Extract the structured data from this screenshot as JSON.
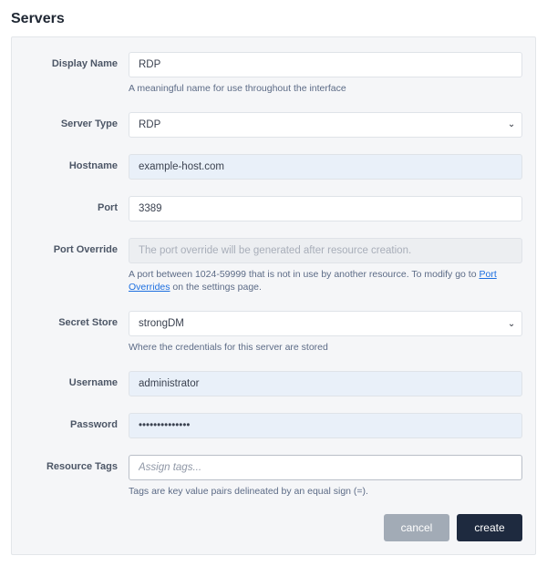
{
  "page_title": "Servers",
  "fields": {
    "display_name": {
      "label": "Display Name",
      "value": "RDP",
      "hint": "A meaningful name for use throughout the interface"
    },
    "server_type": {
      "label": "Server Type",
      "value": "RDP"
    },
    "hostname": {
      "label": "Hostname",
      "value": "example-host.com"
    },
    "port": {
      "label": "Port",
      "value": "3389"
    },
    "port_override": {
      "label": "Port Override",
      "placeholder": "The port override will be generated after resource creation.",
      "hint_pre": "A port between 1024-59999 that is not in use by another resource. To modify go to ",
      "hint_link": "Port Overrides",
      "hint_post": " on the settings page."
    },
    "secret_store": {
      "label": "Secret Store",
      "value": "strongDM",
      "hint": "Where the credentials for this server are stored"
    },
    "username": {
      "label": "Username",
      "value": "administrator"
    },
    "password": {
      "label": "Password",
      "value": "••••••••••••••"
    },
    "resource_tags": {
      "label": "Resource Tags",
      "placeholder": "Assign tags...",
      "hint": "Tags are key value pairs delineated by an equal sign (=)."
    }
  },
  "buttons": {
    "cancel": "cancel",
    "create": "create"
  }
}
